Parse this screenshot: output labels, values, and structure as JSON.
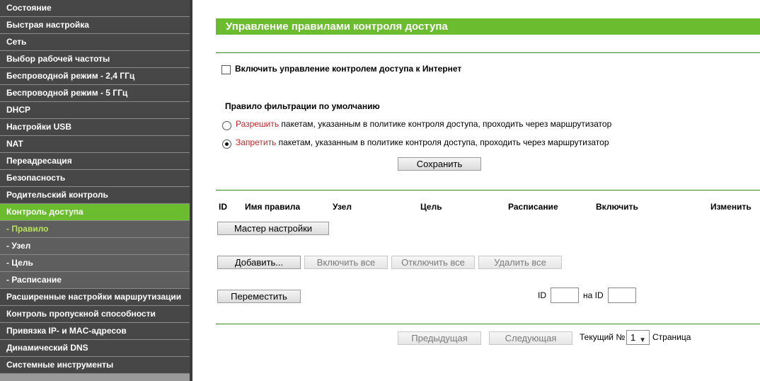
{
  "sidebar": {
    "items": [
      {
        "label": "Состояние"
      },
      {
        "label": "Быстрая настройка"
      },
      {
        "label": "Сеть"
      },
      {
        "label": "Выбор рабочей частоты"
      },
      {
        "label": "Беспроводной режим - 2,4 ГГц"
      },
      {
        "label": "Беспроводной режим - 5 ГГц"
      },
      {
        "label": "DHCP"
      },
      {
        "label": "Настройки USB"
      },
      {
        "label": "NAT"
      },
      {
        "label": "Переадресация"
      },
      {
        "label": "Безопасность"
      },
      {
        "label": "Родительский контроль"
      },
      {
        "label": "Контроль доступа"
      },
      {
        "label": "- Правило"
      },
      {
        "label": "- Узел"
      },
      {
        "label": "- Цель"
      },
      {
        "label": "- Расписание"
      },
      {
        "label": "Расширенные настройки маршрутизации"
      },
      {
        "label": "Контроль пропускной способности"
      },
      {
        "label": "Привязка IP- и MAC-адресов"
      },
      {
        "label": "Динамический DNS"
      },
      {
        "label": "Системные инструменты"
      }
    ],
    "active_index": 12,
    "current_sub_index": 13
  },
  "main": {
    "title": "Управление правилами контроля доступа",
    "enable_label": "Включить управление контролем доступа к Интернет",
    "enable_checked": false,
    "default_rule_heading": "Правило фильтрации по умолчанию",
    "allow_word": "Разрешить",
    "allow_rest": " пакетам, указанным в политике контроля доступа, проходить через маршрутизатор",
    "deny_word": "Запретить",
    "deny_rest": " пакетам, указанным в политике контроля доступа, проходить через маршрутизатор",
    "selected_rule": "deny",
    "save_label": "Сохранить",
    "table_headers": [
      "ID",
      "Имя правила",
      "Узел",
      "Цель",
      "Расписание",
      "Включить",
      "Изменить"
    ],
    "wizard_label": "Мастер настройки",
    "add_label": "Добавить...",
    "enable_all_label": "Включить все",
    "disable_all_label": "Отключить все",
    "delete_all_label": "Удалить все",
    "move_label": "Переместить",
    "id_label": "ID",
    "to_id_label": "на ID",
    "id_from_value": "",
    "id_to_value": "",
    "prev_label": "Предыдущая",
    "next_label": "Следующая",
    "current_label": "Текущий №",
    "page_value": "1",
    "page_label": "Страница"
  },
  "colors": {
    "accent": "#6bbd2f",
    "sidebar_bg": "#474747",
    "warning_red": "#c0272d"
  }
}
